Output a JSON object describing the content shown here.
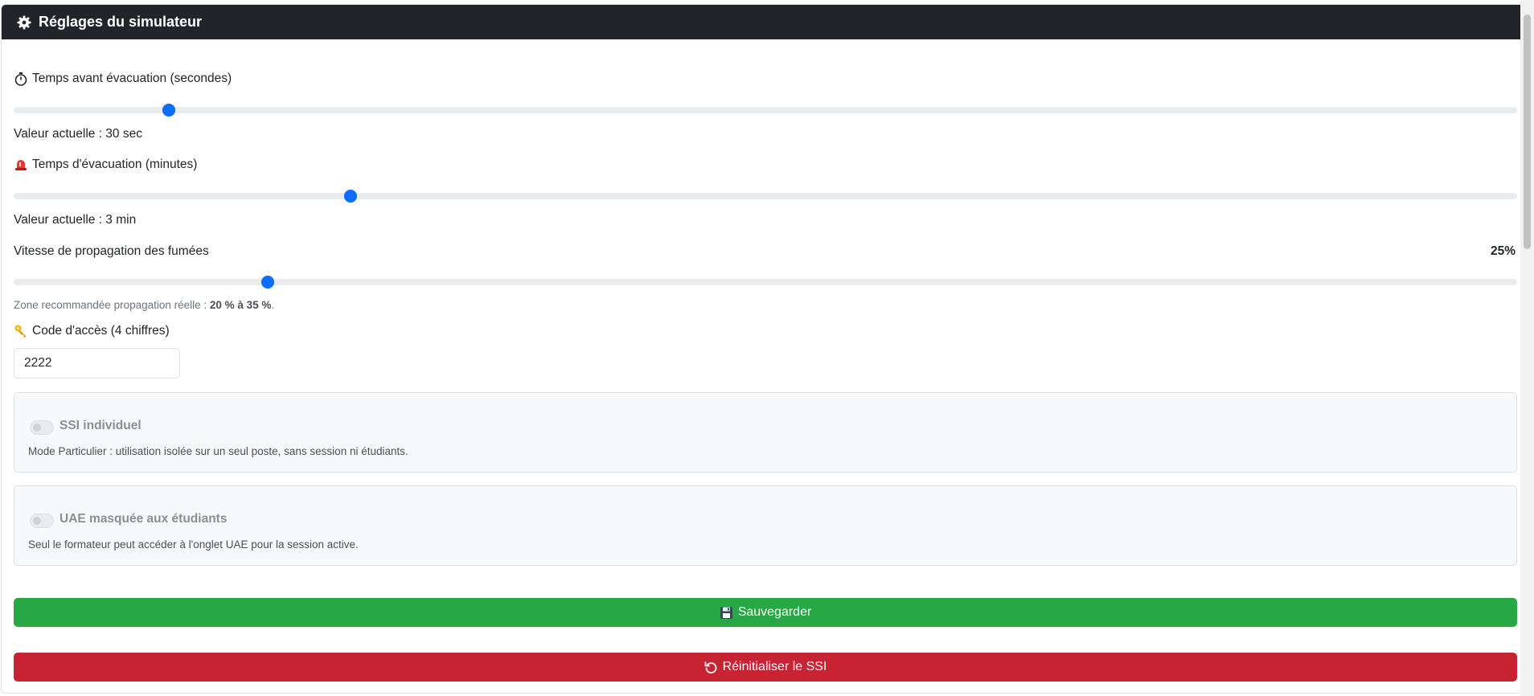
{
  "header": {
    "title": "Réglages du simulateur",
    "icon": "gear-icon"
  },
  "delay_setting": {
    "label": "Temps avant évacuation (secondes)",
    "icon": "stopwatch-icon",
    "slider_fraction": 0.103,
    "value_text": "Valeur actuelle : 30 sec"
  },
  "evacuation_setting": {
    "label": "Temps d'évacuation (minutes)",
    "icon": "alarm-light-icon",
    "slider_fraction": 0.224,
    "value_text": "Valeur actuelle : 3 min"
  },
  "smoke_setting": {
    "label": "Vitesse de propagation des fumées",
    "percent_text": "25%",
    "slider_fraction": 0.169,
    "note_prefix": "Zone recommandée propagation réelle : ",
    "note_bold": "20 % à 35 %",
    "note_suffix": "."
  },
  "access_code": {
    "label": "Code d'accès (4 chiffres)",
    "icon": "key-icon",
    "value": "2222"
  },
  "individual_ssi": {
    "title": "SSI individuel",
    "enabled": false,
    "description": "Mode Particulier : utilisation isolée sur un seul poste, sans session ni étudiants."
  },
  "uae_hidden": {
    "title": "UAE masquée aux étudiants",
    "enabled": false,
    "description": "Seul le formateur peut accéder à l'onglet UAE pour la session active."
  },
  "buttons": {
    "save_label": "Sauvegarder",
    "save_icon": "floppy-disk-icon",
    "reset_label": "Réinitialiser le SSI",
    "reset_icon": "rotate-icon"
  },
  "colors": {
    "header_bg": "#212529",
    "accent": "#0d6efd",
    "save": "#28a745",
    "reset": "#c82333"
  }
}
